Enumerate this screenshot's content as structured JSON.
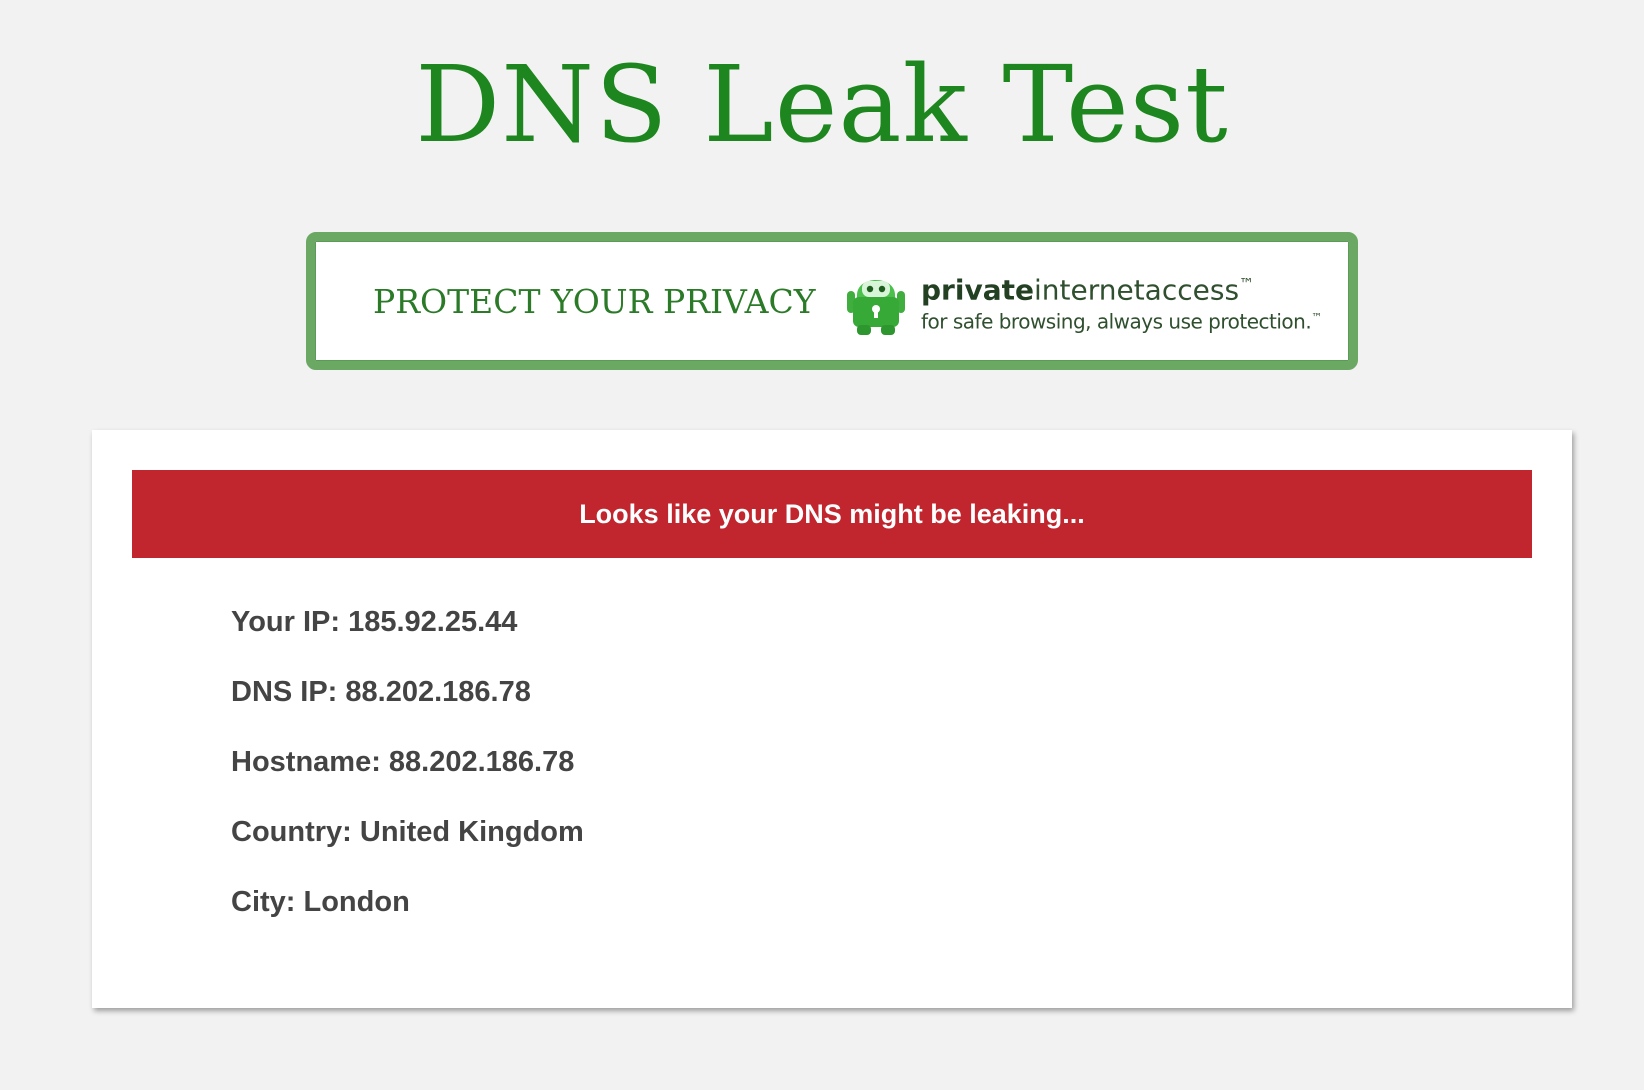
{
  "page": {
    "title": "DNS Leak Test"
  },
  "banner": {
    "tagline": "PROTECT YOUR PRIVACY",
    "brand_bold": "private",
    "brand_rest": "internetaccess",
    "brand_tm": "™",
    "slogan": "for safe browsing, always use protection.",
    "slogan_tm": "™",
    "logo_icon": "pia-robot-lock-icon",
    "border_color": "#6aa864",
    "text_color": "#2b7a28"
  },
  "result": {
    "alert": "Looks like your DNS might be leaking...",
    "alert_color": "#c1262e",
    "rows": [
      "Your IP: 185.92.25.44",
      "DNS IP: 88.202.186.78",
      "Hostname: 88.202.186.78",
      "Country: United Kingdom",
      "City: London"
    ]
  },
  "colors": {
    "title": "#1e861e",
    "background": "#f2f2f2",
    "card": "#ffffff",
    "body_text": "#444444"
  }
}
